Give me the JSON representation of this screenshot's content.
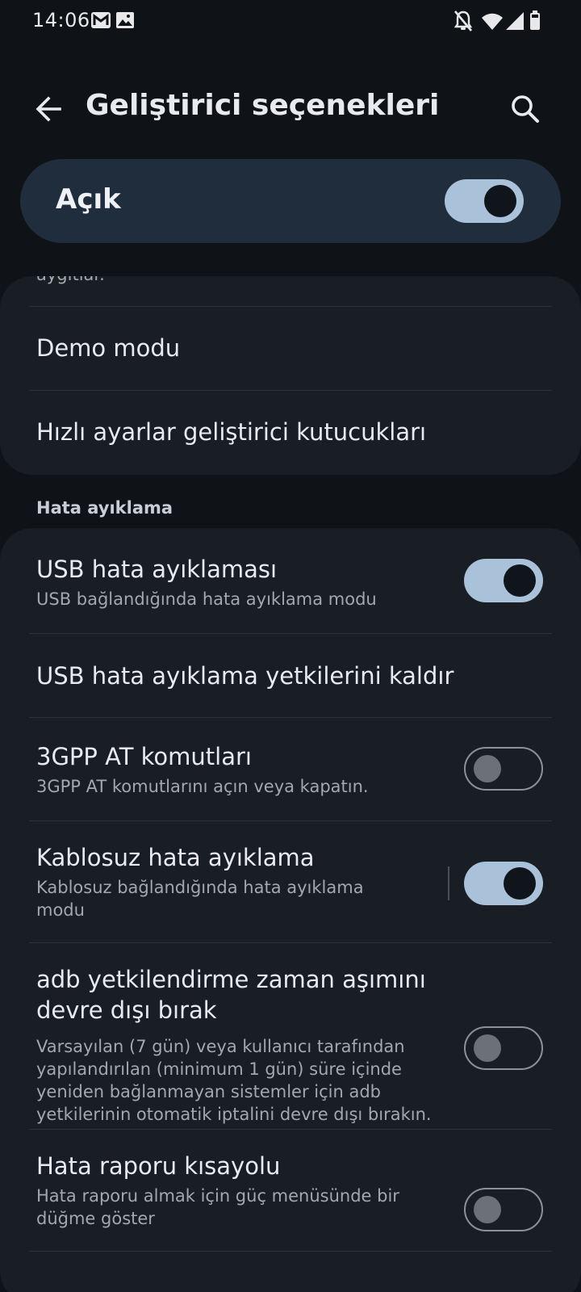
{
  "status_bar": {
    "time": "14:06",
    "left_icons": [
      "gmail-icon",
      "image-icon"
    ],
    "right_icons": [
      "notifications-off-icon",
      "wifi-icon",
      "signal-icon",
      "battery-icon"
    ]
  },
  "app_bar": {
    "title": "Geliştirici seçenekleri",
    "back_icon": "arrow-left-icon",
    "search_icon": "search-icon"
  },
  "master_switch": {
    "label": "Açık",
    "checked": true
  },
  "top_card": {
    "partial_text": "aygıtlar.",
    "items": [
      {
        "title": "Demo modu"
      },
      {
        "title": "Hızlı ayarlar geliştirici kutucukları"
      }
    ]
  },
  "debug_section": {
    "header": "Hata ayıklama",
    "items": [
      {
        "title": "USB hata ayıklaması",
        "summary": "USB bağlandığında hata ayıklama modu",
        "checked": true
      },
      {
        "title": "USB hata ayıklama yetkilerini kaldır"
      },
      {
        "title": "3GPP AT komutları",
        "summary": "3GPP AT komutlarını açın veya kapatın.",
        "checked": false
      },
      {
        "title": "Kablosuz hata ayıklama",
        "summary": "Kablosuz bağlandığında hata ayıklama modu",
        "checked": true
      },
      {
        "title_line1": "adb yetkilendirme zaman aşımını",
        "title_line2": "devre dışı bırak",
        "summary": "Varsayılan (7 gün) veya kullanıcı tarafından yapılandırılan (minimum 1 gün) süre içinde yeniden bağlanmayan sistemler için adb yetkilerinin otomatik iptalini devre dışı bırakın.",
        "checked": false
      },
      {
        "title": "Hata raporu kısayolu",
        "summary": "Hata raporu almak için güç menüsünde bir düğme göster",
        "checked": false
      }
    ]
  },
  "colors": {
    "background": "#0f1216",
    "card": "#191d24",
    "master_bg": "#1f2d3d",
    "toggle_on": "#a9c1d9",
    "text_primary": "#e8eaef",
    "text_secondary": "#a2a7b0"
  }
}
